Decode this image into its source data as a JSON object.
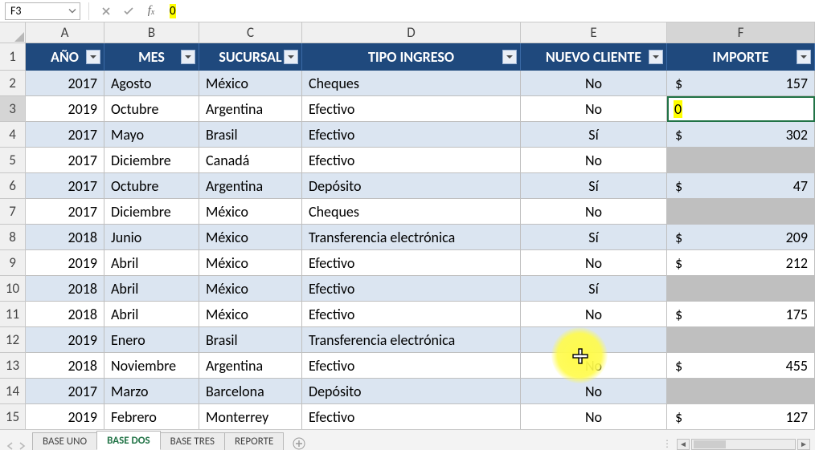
{
  "nameBox": "F3",
  "formulaValue": "0",
  "columns": [
    "A",
    "B",
    "C",
    "D",
    "E",
    "F"
  ],
  "activeCol": "F",
  "activeRow": 3,
  "headers": {
    "A": "AÑO",
    "B": "MES",
    "C": "SUCURSAL",
    "D": "TIPO INGRESO",
    "E": "NUEVO CLIENTE",
    "F": "IMPORTE"
  },
  "rows": [
    {
      "n": 2,
      "ano": "2017",
      "mes": "Agosto",
      "suc": "México",
      "tipo": "Cheques",
      "nuevo": "No",
      "imp": "157",
      "alt": true
    },
    {
      "n": 3,
      "ano": "2019",
      "mes": "Octubre",
      "suc": "Argentina",
      "tipo": "Efectivo",
      "nuevo": "No",
      "imp": "0",
      "alt": false,
      "active": true
    },
    {
      "n": 4,
      "ano": "2017",
      "mes": "Mayo",
      "suc": "Brasil",
      "tipo": "Efectivo",
      "nuevo": "Sí",
      "imp": "302",
      "alt": true
    },
    {
      "n": 5,
      "ano": "2017",
      "mes": "Diciembre",
      "suc": "Canadá",
      "tipo": "Efectivo",
      "nuevo": "No",
      "imp": "",
      "alt": false,
      "gray": true
    },
    {
      "n": 6,
      "ano": "2017",
      "mes": "Octubre",
      "suc": "Argentina",
      "tipo": "Depósito",
      "nuevo": "Sí",
      "imp": "47",
      "alt": true
    },
    {
      "n": 7,
      "ano": "2017",
      "mes": "Diciembre",
      "suc": "México",
      "tipo": "Cheques",
      "nuevo": "No",
      "imp": "",
      "alt": false,
      "gray": true
    },
    {
      "n": 8,
      "ano": "2018",
      "mes": "Junio",
      "suc": "México",
      "tipo": "Transferencia electrónica",
      "nuevo": "Sí",
      "imp": "209",
      "alt": true
    },
    {
      "n": 9,
      "ano": "2019",
      "mes": "Abril",
      "suc": "México",
      "tipo": "Efectivo",
      "nuevo": "No",
      "imp": "212",
      "alt": false
    },
    {
      "n": 10,
      "ano": "2018",
      "mes": "Abril",
      "suc": "México",
      "tipo": "Efectivo",
      "nuevo": "Sí",
      "imp": "",
      "alt": true,
      "gray": true
    },
    {
      "n": 11,
      "ano": "2018",
      "mes": "Abril",
      "suc": "México",
      "tipo": "Efectivo",
      "nuevo": "No",
      "imp": "175",
      "alt": false
    },
    {
      "n": 12,
      "ano": "2019",
      "mes": "Enero",
      "suc": "Brasil",
      "tipo": "Transferencia electrónica",
      "nuevo": "",
      "imp": "",
      "alt": true,
      "gray": true,
      "cursor": true
    },
    {
      "n": 13,
      "ano": "2018",
      "mes": "Noviembre",
      "suc": "Argentina",
      "tipo": "Efectivo",
      "nuevo": "No",
      "imp": "455",
      "alt": false
    },
    {
      "n": 14,
      "ano": "2017",
      "mes": "Marzo",
      "suc": "Barcelona",
      "tipo": "Depósito",
      "nuevo": "No",
      "imp": "",
      "alt": true,
      "gray": true
    },
    {
      "n": 15,
      "ano": "2019",
      "mes": "Febrero",
      "suc": "Monterrey",
      "tipo": "Efectivo",
      "nuevo": "No",
      "imp": "127",
      "alt": false
    }
  ],
  "tabs": [
    "BASE UNO",
    "BASE DOS",
    "BASE TRES",
    "REPORTE"
  ],
  "activeTab": 1,
  "currency": "$"
}
